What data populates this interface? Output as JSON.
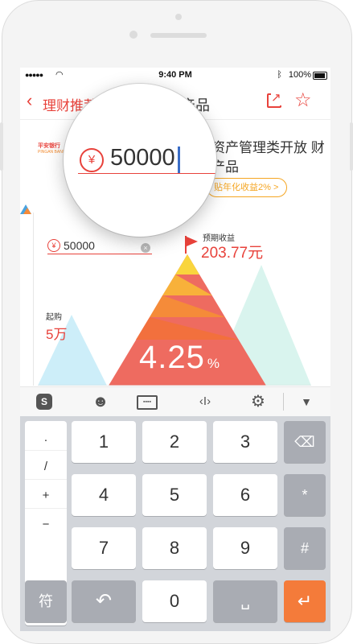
{
  "status_bar": {
    "time": "9:40 PM",
    "battery": "100%"
  },
  "nav": {
    "back_label": "理财推荐",
    "title": "产品"
  },
  "product": {
    "logo_main": "平安银行",
    "logo_sub": "PINGAN BANK",
    "title": "资产管理类开放 财产品",
    "subsidy": "贴年化收益2% >"
  },
  "calculator": {
    "amount_value": "50000",
    "magnifier_value": "50000",
    "currency_symbol": "¥",
    "expected_label": "预期收益",
    "expected_value": "203.77元",
    "min_label": "起购",
    "min_value": "5万",
    "rate_value": "4.25",
    "rate_unit": "%"
  },
  "colors": {
    "accent": "#e8423b",
    "orange": "#f47b3a",
    "pyramid_top": "#f9c93a"
  },
  "toolbar": {
    "items": [
      "sogou-logo-icon",
      "emoji-icon",
      "keyboard-icon",
      "cursor-icon",
      "gear-icon",
      "collapse-icon"
    ],
    "logo_text": "S"
  },
  "keyboard": {
    "symbols": [
      ".",
      "/",
      "+",
      "−"
    ],
    "rows": [
      [
        "1",
        "2",
        "3"
      ],
      [
        "4",
        "5",
        "6"
      ],
      [
        "7",
        "8",
        "9"
      ],
      [
        "符",
        "",
        "0",
        ""
      ]
    ],
    "right_keys": [
      "⌫",
      "*",
      "#",
      "↵"
    ]
  }
}
